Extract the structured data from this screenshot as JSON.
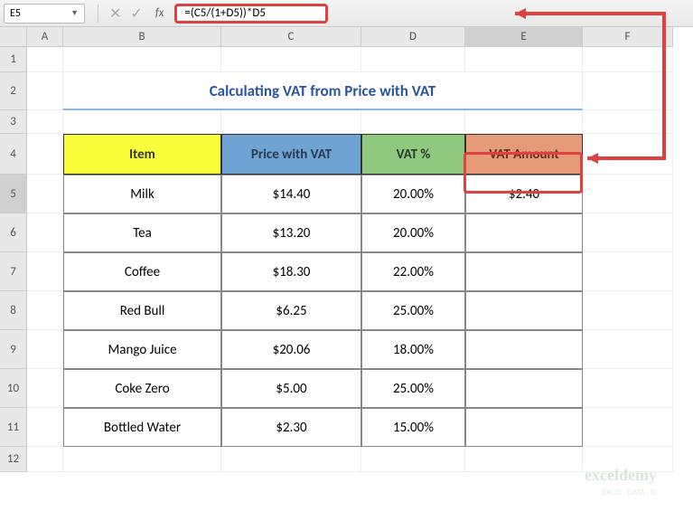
{
  "nameBox": "E5",
  "formula": "=(C5/(1+D5))*D5",
  "columns": [
    "A",
    "B",
    "C",
    "D",
    "E",
    "F"
  ],
  "rows": [
    "1",
    "2",
    "3",
    "4",
    "5",
    "6",
    "7",
    "8",
    "9",
    "10",
    "11",
    "12"
  ],
  "title": "Calculating VAT from Price with VAT",
  "headers": {
    "item": "Item",
    "price": "Price with VAT",
    "vat": "VAT %",
    "amount": "VAT Amount"
  },
  "data": [
    {
      "item": "Milk",
      "price": "$14.40",
      "vat": "20.00%",
      "amount": "$2.40"
    },
    {
      "item": "Tea",
      "price": "$13.20",
      "vat": "20.00%",
      "amount": ""
    },
    {
      "item": "Coffee",
      "price": "$18.30",
      "vat": "22.00%",
      "amount": ""
    },
    {
      "item": "Red Bull",
      "price": "$6.25",
      "vat": "25.00%",
      "amount": ""
    },
    {
      "item": "Mango Juice",
      "price": "$20.06",
      "vat": "18.00%",
      "amount": ""
    },
    {
      "item": "Coke Zero",
      "price": "$5.00",
      "vat": "25.00%",
      "amount": ""
    },
    {
      "item": "Bottled Water",
      "price": "$2.30",
      "vat": "15.00%",
      "amount": ""
    }
  ],
  "watermark": "exceldemy",
  "watermarkSub": "EXCEL · DATA · BI"
}
